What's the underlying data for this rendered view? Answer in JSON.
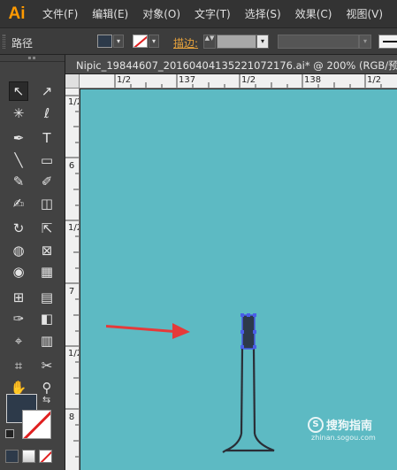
{
  "app": {
    "logo": "Ai",
    "menu": [
      "文件(F)",
      "编辑(E)",
      "对象(O)",
      "文字(T)",
      "选择(S)",
      "效果(C)",
      "视图(V)"
    ]
  },
  "control_bar": {
    "object_label": "路径",
    "stroke_label": "描边:",
    "dropdown_glyph": "▾",
    "spinner_glyph": "▲▼",
    "fill_color": "#2d3a4a",
    "stroke_color": "none"
  },
  "toolbox": {
    "grip": "▪▪",
    "tools": [
      [
        "↖",
        "↗"
      ],
      [
        "✳",
        "ℓ"
      ],
      [
        "✒",
        "T"
      ],
      [
        "╲",
        "▭"
      ],
      [
        "✎",
        "✐"
      ],
      [
        "✍",
        "◫"
      ],
      [
        "↻",
        "⇱"
      ],
      [
        "◍",
        "⊠"
      ],
      [
        "◉",
        "▦"
      ],
      [
        "⊞",
        "▤"
      ],
      [
        "✑",
        "◧"
      ],
      [
        "⌖",
        "▥"
      ],
      [
        "⌗",
        "✂"
      ],
      [
        "✋",
        "⚲"
      ]
    ],
    "swap_glyph": "⇆"
  },
  "document": {
    "tab_title": "Nipic_19844607_20160404135221072176.ai*  @  200%  (RGB/预"
  },
  "ruler_top_labels": [
    "1/2",
    "137",
    "1/2",
    "138",
    "1/2"
  ],
  "ruler_left_labels": [
    "1/2",
    "6",
    "1/2",
    "7",
    "1/2",
    "8"
  ],
  "watermark": {
    "icon": "S",
    "text": "搜狗指南",
    "sub": "zhinan.sogou.com"
  },
  "colors": {
    "canvas": "#5dbac3",
    "arrow": "#e53a3a",
    "shape_outline": "#2a2e36",
    "selection": "#4a5ee8"
  }
}
